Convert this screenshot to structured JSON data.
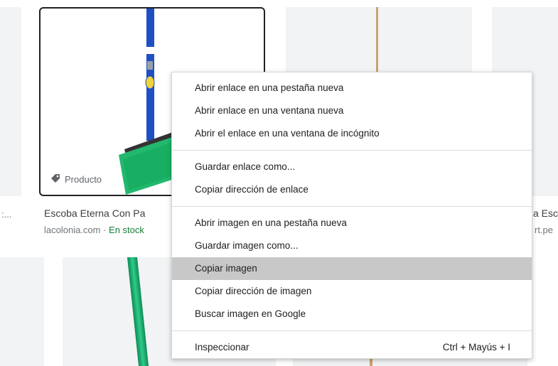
{
  "results": {
    "selected_card": {
      "badge_label": "Producto",
      "title": "Escoba Eterna Con Pa",
      "source": "lacolonia.com · ",
      "stock": "En stock"
    },
    "left_fragment": ":...",
    "right_title_fragment": "a Esc",
    "right_source_fragment": "rt.pe"
  },
  "context_menu": {
    "groups": [
      [
        {
          "label": "Abrir enlace en una pestaña nueva"
        },
        {
          "label": "Abrir enlace en una ventana nueva"
        },
        {
          "label": "Abrir el enlace en una ventana de incógnito"
        }
      ],
      [
        {
          "label": "Guardar enlace como..."
        },
        {
          "label": "Copiar dirección de enlace"
        }
      ],
      [
        {
          "label": "Abrir imagen en una pestaña nueva"
        },
        {
          "label": "Guardar imagen como..."
        },
        {
          "label": "Copiar imagen",
          "highlighted": true
        },
        {
          "label": "Copiar dirección de imagen"
        },
        {
          "label": "Buscar imagen en Google"
        }
      ],
      [
        {
          "label": "Inspeccionar",
          "shortcut": "Ctrl + Mayús + I"
        }
      ]
    ]
  },
  "colors": {
    "highlight": "#c8c8c8",
    "stock_green": "#188038",
    "broom_handle_blue": "#1f4fc4",
    "broom_bristles_green": "#1db36b"
  }
}
